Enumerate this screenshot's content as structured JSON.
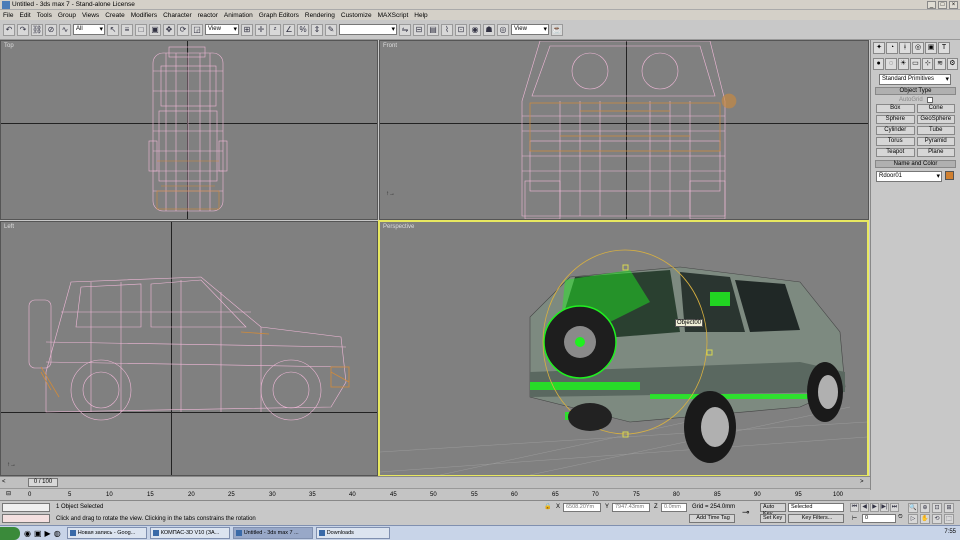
{
  "window": {
    "title": "Untitled - 3ds max 7 - Stand-alone License"
  },
  "menu": [
    "File",
    "Edit",
    "Tools",
    "Group",
    "Views",
    "Create",
    "Modifiers",
    "Character",
    "reactor",
    "Animation",
    "Graph Editors",
    "Rendering",
    "Customize",
    "MAXScript",
    "Help"
  ],
  "toolbar": {
    "selection_filter": "All",
    "ref_coord": "View",
    "named_sel": "",
    "render_view": "View"
  },
  "viewports": {
    "top": "Top",
    "front": "Front",
    "left": "Left",
    "perspective": "Perspective"
  },
  "scene": {
    "object_label": "Object00"
  },
  "command_panel": {
    "category": "Standard Primitives",
    "object_type_header": "Object Type",
    "autogrid": "AutoGrid",
    "buttons": [
      "Box",
      "Cone",
      "Sphere",
      "GeoSphere",
      "Cylinder",
      "Tube",
      "Torus",
      "Pyramid",
      "Teapot",
      "Plane"
    ],
    "name_color_header": "Name and Color",
    "object_name": "Rdoor01",
    "object_color": "#d08030"
  },
  "time": {
    "slider": "0 / 100",
    "ticks": [
      "0",
      "5",
      "10",
      "15",
      "20",
      "25",
      "30",
      "35",
      "40",
      "45",
      "50",
      "55",
      "60",
      "65",
      "70",
      "75",
      "80",
      "85",
      "90",
      "95",
      "100"
    ]
  },
  "status": {
    "selection": "1 Object Selected",
    "prompt": "Click and drag to rotate the view.  Clicking in the tabs constrains the rotation",
    "x": "6508.20Ym",
    "y": "7947.43mm",
    "z": "0.0mm",
    "grid": "Grid = 254.0mm",
    "add_time_tag": "Add Time Tag",
    "auto_key": "Auto Key",
    "set_key": "Set Key",
    "key_mode": "Selected",
    "key_filters": "Key Filters...",
    "frame": "0"
  },
  "taskbar": {
    "start": "",
    "tasks": [
      "Новая запись - Goog...",
      "КОМПАС-3D V10 (ЗА...",
      "Untitled - 3ds max 7 ...",
      "Downloads"
    ],
    "clock": "7:55"
  },
  "colors": {
    "wire_pink": "#f0b8d8",
    "wire_orange": "#d08a3a",
    "selection_green": "#20f020",
    "viewport_bg": "#808080"
  }
}
